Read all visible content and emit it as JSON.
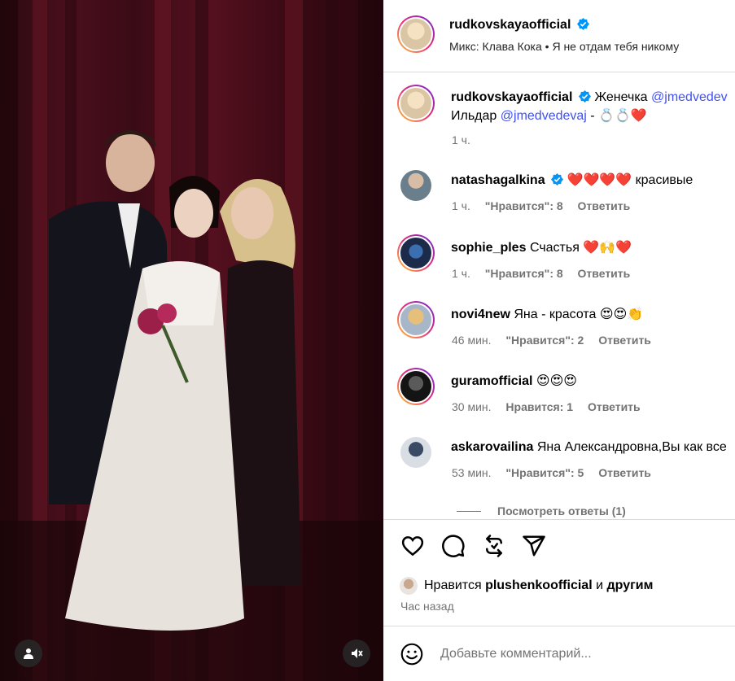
{
  "header": {
    "username": "rudkovskayaofficial",
    "audio": "Микс: Клава Кока • Я не отдам тебя никому"
  },
  "caption": {
    "username": "rudkovskayaofficial",
    "text_before": "Женечка",
    "mention1": "@jmedvedev",
    "line2_prefix": "Ильдар",
    "mention2": "@jmedvedevaj",
    "line2_suffix": " - 💍💍❤️",
    "time": "1 ч."
  },
  "comments": [
    {
      "username": "natashagalkina",
      "verified": true,
      "text": "❤️❤️❤️❤️ красивые",
      "time": "1 ч.",
      "likes": "\"Нравится\": 8",
      "reply": "Ответить"
    },
    {
      "username": "sophie_ples",
      "verified": false,
      "text": "Счастья ❤️🙌❤️",
      "time": "1 ч.",
      "likes": "\"Нравится\": 8",
      "reply": "Ответить"
    },
    {
      "username": "novi4new",
      "verified": false,
      "text": "Яна - красота 😍😍👏",
      "time": "46 мин.",
      "likes": "\"Нравится\": 2",
      "reply": "Ответить"
    },
    {
      "username": "guramofficial",
      "verified": false,
      "text": "😍😍😍",
      "time": "30 мин.",
      "likes": "Нравится: 1",
      "reply": "Ответить"
    },
    {
      "username": "askarovailina",
      "verified": false,
      "text": "Яна Александровна,Вы как все",
      "time": "53 мин.",
      "likes": "\"Нравится\": 5",
      "reply": "Ответить"
    }
  ],
  "view_replies": "Посмотреть ответы (1)",
  "likes_line": {
    "prefix": "Нравится",
    "user": "plushenkoofficial",
    "middle": "и",
    "suffix": "другим"
  },
  "time_ago": "Час назад",
  "add_comment": {
    "placeholder": "Добавьте комментарий..."
  },
  "colors": {
    "link": "#4150f7",
    "muted": "#737373",
    "heart": "#e0143c",
    "verified": "#0095f6"
  }
}
